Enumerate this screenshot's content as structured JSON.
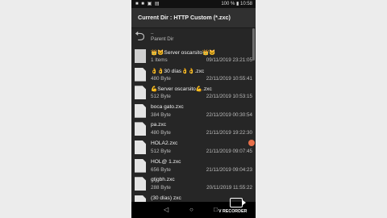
{
  "status": {
    "time": "10:58",
    "battery": "100 %"
  },
  "title": "Current Dir : HTTP Custom (*.zxc)",
  "parent": {
    "name": "..",
    "label": "Parent Dir"
  },
  "rows": [
    {
      "name": "👑🐱Server oscarsito👑🐱",
      "size": "1 Items",
      "date": "09/11/2019 23:21:05",
      "type": "folder"
    },
    {
      "name": "👌👌30 días👌👌.zxc",
      "size": "480 Byte",
      "date": "22/11/2019 10:55:41",
      "type": "file"
    },
    {
      "name": "💪Server oscarsito💪.zxc",
      "size": "512 Byte",
      "date": "22/11/2019 10:53:15",
      "type": "file"
    },
    {
      "name": "boca gato.zxc",
      "size": "384 Byte",
      "date": "22/11/2019 00:30:54",
      "type": "file"
    },
    {
      "name": "pa.zxc",
      "size": "480 Byte",
      "date": "21/11/2019 19:22:30",
      "type": "file"
    },
    {
      "name": "HOLA2.zxc",
      "size": "512 Byte",
      "date": "21/11/2019 09:07:45",
      "type": "file"
    },
    {
      "name": "HOL@ 1.zxc",
      "size": "656 Byte",
      "date": "21/11/2019 09:04:23",
      "type": "file"
    },
    {
      "name": "gtjgbh.zxc",
      "size": "288 Byte",
      "date": "20/11/2019 11:55:22",
      "type": "file"
    },
    {
      "name": "(30 días) zxc",
      "size": "",
      "date": "",
      "type": "file"
    }
  ],
  "recorder": {
    "label": "V RECORDER"
  }
}
